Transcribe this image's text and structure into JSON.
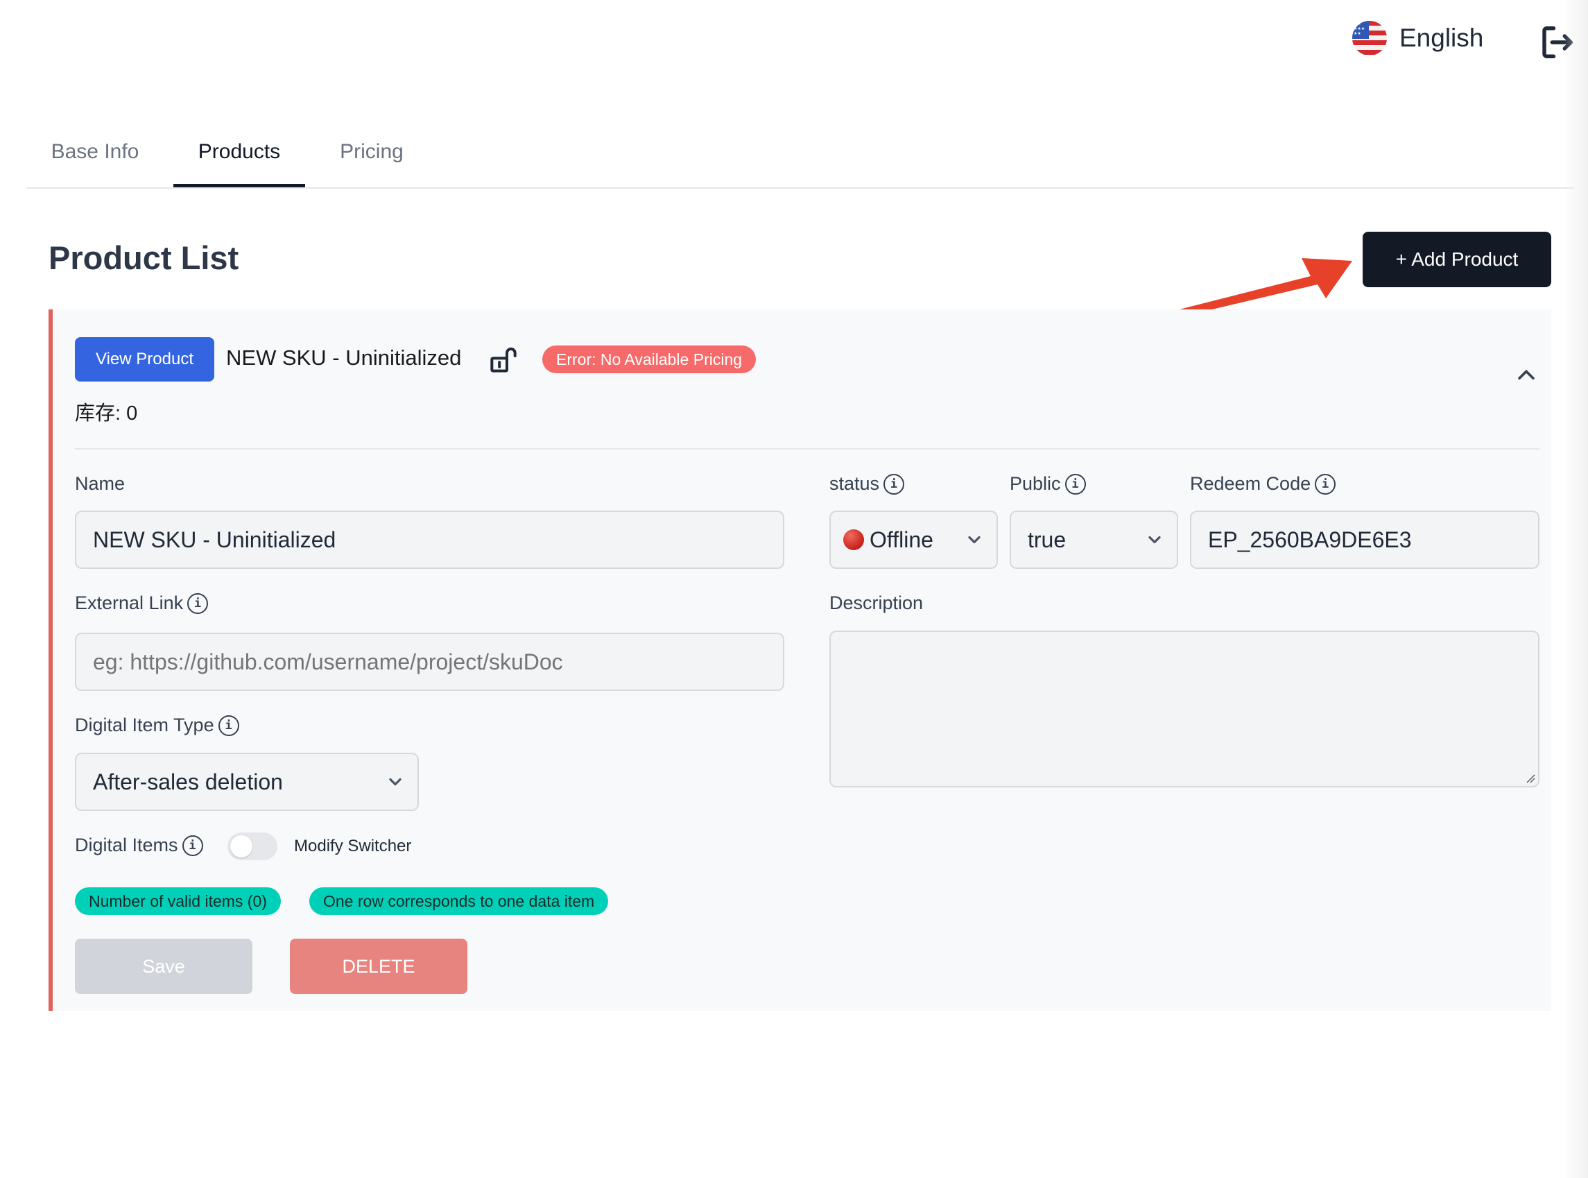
{
  "header": {
    "language": {
      "label": "English",
      "flag_icon": "us-flag-icon"
    },
    "logout_icon": "logout-icon"
  },
  "tabs": [
    {
      "label": "Base Info",
      "active": false
    },
    {
      "label": "Products",
      "active": true
    },
    {
      "label": "Pricing",
      "active": false
    }
  ],
  "page": {
    "title": "Product List",
    "add_button": "+ Add Product"
  },
  "colors": {
    "accent_dark": "#131a26",
    "primary_blue": "#3464e0",
    "error_red": "#f76a6a",
    "card_border": "#e0625c",
    "teal_pill": "#00d0b8",
    "annotation_arrow": "#e8412a"
  },
  "product": {
    "view_button": "View Product",
    "title": "NEW SKU - Uninitialized",
    "lock_icon": "unlocked-padlock-icon",
    "error_badge": "Error: No Available Pricing",
    "stock": "库存: 0",
    "collapse_icon": "chevron-up-icon",
    "fields": {
      "name": {
        "label": "Name",
        "value": "NEW SKU - Uninitialized"
      },
      "status": {
        "label": "status",
        "value": "Offline",
        "status_color": "#d32f2a"
      },
      "public": {
        "label": "Public",
        "value": "true"
      },
      "redeem_code": {
        "label": "Redeem Code",
        "value": "EP_2560BA9DE6E3"
      },
      "external_link": {
        "label": "External Link",
        "value": "",
        "placeholder": "eg: https://github.com/username/project/skuDoc"
      },
      "description": {
        "label": "Description",
        "value": ""
      },
      "digital_item_type": {
        "label": "Digital Item Type",
        "value": "After-sales deletion"
      },
      "digital_items": {
        "label": "Digital Items",
        "toggle_on": false,
        "toggle_label": "Modify Switcher"
      }
    },
    "pills": [
      "Number of valid items (0)",
      "One row corresponds to one data item"
    ],
    "save_button": "Save",
    "delete_button": "DELETE"
  }
}
